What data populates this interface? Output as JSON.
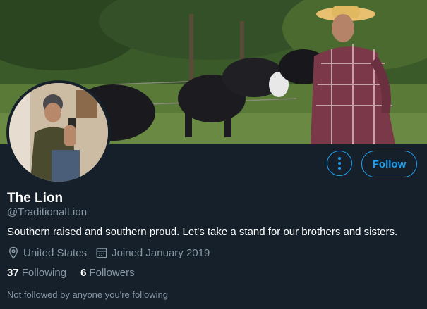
{
  "profile": {
    "display_name": "The Lion",
    "handle": "@TraditionalLion",
    "bio": "Southern raised and southern proud. Let's take a stand for our brothers and sisters.",
    "location": "United States",
    "joined": "Joined January 2019",
    "following_count": "37",
    "following_label": "Following",
    "followers_count": "6",
    "followers_label": "Followers",
    "social_context": "Not followed by anyone you're following"
  },
  "actions": {
    "follow_label": "Follow",
    "more_icon": "more-vertical-icon"
  },
  "colors": {
    "background": "#15202b",
    "accent": "#1da1f2",
    "secondary_text": "#8899a6",
    "primary_text": "#ffffff"
  },
  "icons": {
    "location": "location-pin-icon",
    "calendar": "calendar-icon"
  }
}
